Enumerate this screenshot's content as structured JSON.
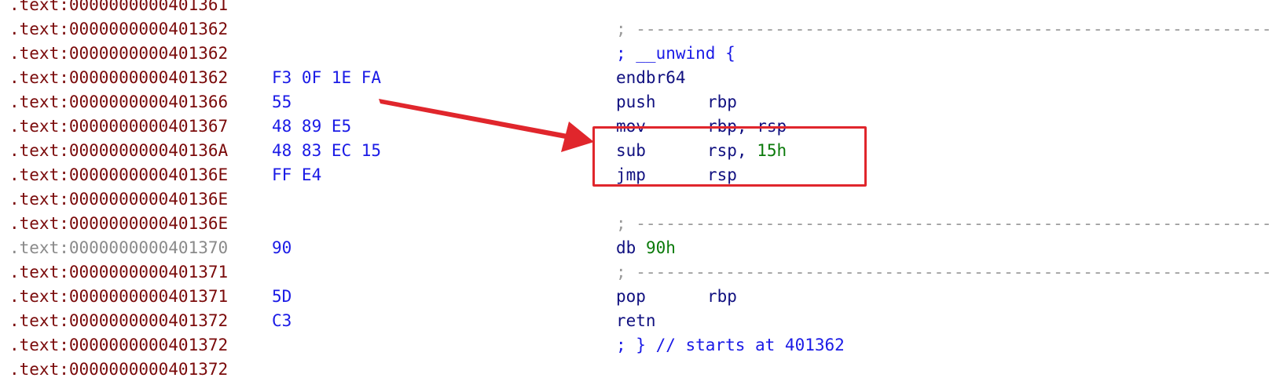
{
  "listing": {
    "lines": [
      {
        "addr": ".text:0000000000401361",
        "bytes": "",
        "asm_type": "blank",
        "tone": "red"
      },
      {
        "addr": ".text:0000000000401362",
        "bytes": "",
        "asm_type": "sep",
        "sep": "; ---------------------------------------------------------------------------",
        "tone": "red"
      },
      {
        "addr": ".text:0000000000401362",
        "bytes": "",
        "asm_type": "comment",
        "text": "; __unwind {",
        "tone": "red"
      },
      {
        "addr": ".text:0000000000401362",
        "bytes": "F3 0F 1E FA",
        "asm_type": "instr",
        "mnem": "endbr64",
        "ops": "",
        "imm": "",
        "tone": "red"
      },
      {
        "addr": ".text:0000000000401366",
        "bytes": "55",
        "asm_type": "instr",
        "mnem": "push",
        "ops": "rbp",
        "imm": "",
        "tone": "red"
      },
      {
        "addr": ".text:0000000000401367",
        "bytes": "48 89 E5",
        "asm_type": "instr",
        "mnem": "mov",
        "ops": "rbp, rsp",
        "imm": "",
        "tone": "red"
      },
      {
        "addr": ".text:000000000040136A",
        "bytes": "48 83 EC 15",
        "asm_type": "instr",
        "mnem": "sub",
        "ops": "rsp, ",
        "imm": "15h",
        "tone": "red"
      },
      {
        "addr": ".text:000000000040136E",
        "bytes": "FF E4",
        "asm_type": "instr",
        "mnem": "jmp",
        "ops": "rsp",
        "imm": "",
        "tone": "red"
      },
      {
        "addr": ".text:000000000040136E",
        "bytes": "",
        "asm_type": "blank",
        "tone": "red"
      },
      {
        "addr": ".text:000000000040136E",
        "bytes": "",
        "asm_type": "sep",
        "sep": "; ---------------------------------------------------------------------------",
        "tone": "red"
      },
      {
        "addr_prefix": ".text:",
        "addr_rest": "0000000000401370",
        "bytes": "90",
        "asm_type": "data",
        "mnem": "db",
        "imm": "90h",
        "tone": "grey"
      },
      {
        "addr": ".text:0000000000401371",
        "bytes": "",
        "asm_type": "sep",
        "sep": "; ---------------------------------------------------------------------------",
        "tone": "red"
      },
      {
        "addr": ".text:0000000000401371",
        "bytes": "5D",
        "asm_type": "instr",
        "mnem": "pop",
        "ops": "rbp",
        "imm": "",
        "tone": "red"
      },
      {
        "addr": ".text:0000000000401372",
        "bytes": "C3",
        "asm_type": "instr",
        "mnem": "retn",
        "ops": "",
        "imm": "",
        "tone": "red"
      },
      {
        "addr": ".text:0000000000401372",
        "bytes": "",
        "asm_type": "comment",
        "text": "; } // starts at 401362",
        "tone": "red"
      },
      {
        "addr": ".text:0000000000401372",
        "bytes": "",
        "asm_type": "blank",
        "tone": "red"
      }
    ]
  },
  "annotation": {
    "highlight_color": "#e0262c"
  }
}
